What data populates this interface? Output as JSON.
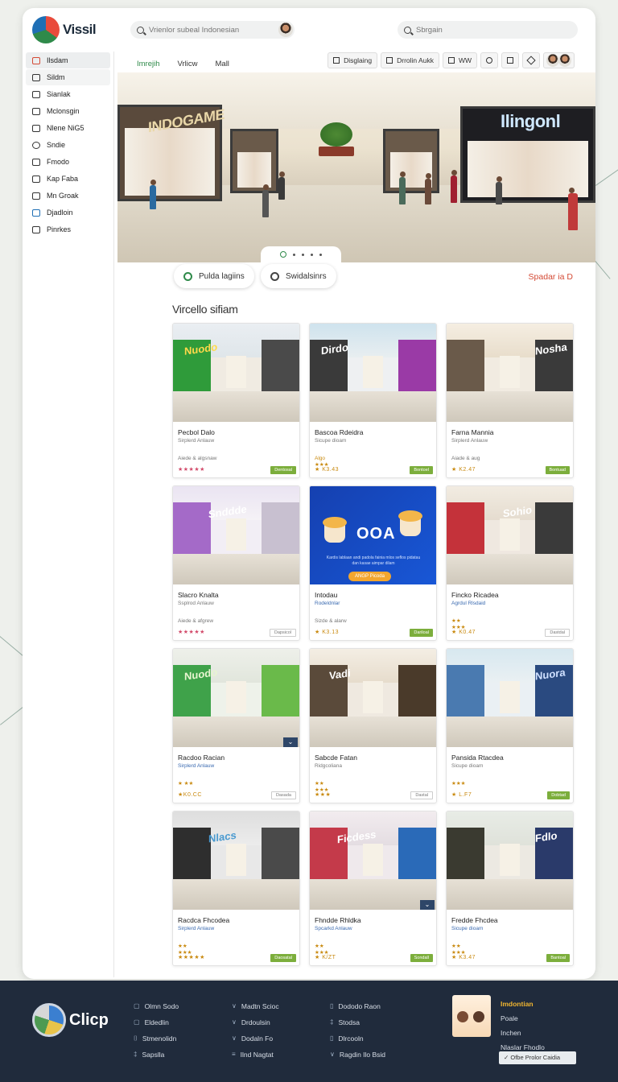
{
  "app": {
    "name": "Vissil"
  },
  "search_main": {
    "placeholder": "Vrienlor subeal Indonesian"
  },
  "search_right": {
    "placeholder": "Sbrgain"
  },
  "sidebar": {
    "items": [
      {
        "label": "Ilsdam",
        "icon": "map-icon"
      },
      {
        "label": "Sildm",
        "icon": "tag-icon"
      },
      {
        "label": "Sianlak",
        "icon": "store-icon"
      },
      {
        "label": "Mclonsgin",
        "icon": "chat-icon"
      },
      {
        "label": "Nlene NiG5",
        "icon": "news-icon"
      },
      {
        "label": "Sndie",
        "icon": "location-icon"
      },
      {
        "label": "Fmodo",
        "icon": "food-icon"
      },
      {
        "label": "Kap Faba",
        "icon": "gift-icon"
      },
      {
        "label": "Mn Groak",
        "icon": "camera-icon"
      },
      {
        "label": "Djadloin",
        "icon": "image-icon"
      },
      {
        "label": "Pinrkes",
        "icon": "users-icon"
      }
    ]
  },
  "topnav": [
    "Imrejih",
    "Vrlicw",
    "Mall"
  ],
  "toolbar": {
    "btn1": "Disglaing",
    "btn2": "Drrolin Aukk",
    "btn3": "WW"
  },
  "hero": {
    "sign_left": "INDOGAME",
    "sign_right": "Ilingonl"
  },
  "pills": {
    "left": "Pulda lagiins",
    "right": "Swidalsinrs"
  },
  "spotlight_link": "Spadar ia D",
  "section_title": "Vircello sifiam",
  "cards": [
    {
      "title": "Pecbol Dalo",
      "sub": "Sirplerd Anlauw",
      "meta": "Aiede & algsnaw",
      "rating": "★★★★★",
      "btn": "Dentosal",
      "sign": "Nuodo"
    },
    {
      "title": "Bascoa Rdeidra",
      "sub": "Sicupe dioam",
      "meta": "Algo\n★★★",
      "rating": "★ K3.43",
      "btn": "Bontoel",
      "sign": "Dirdo"
    },
    {
      "title": "Farna Mannia",
      "sub": "Sirplerd Anlauw",
      "meta": "Aiade & aug",
      "rating": "★ K2.47",
      "btn": "Bontuad",
      "sign": "Nosha"
    },
    {
      "title": "Slacro Knalta",
      "sub": "Ssplrod Anlauw",
      "meta": "Aiede & afgrew",
      "rating": "★★★★★",
      "btn": "Dapsicol",
      "sign": "Snddde"
    },
    {
      "title": "Intodau",
      "sub": "Rodeldnlar",
      "meta": "Sizde & alarw",
      "rating": "★ K3.13",
      "btn": "Dariloal",
      "promo": "OOA",
      "promo_desc": "Kardis lablaan andi padola fainia mlos seflos pidatau dan kasae aimpar dilam",
      "promo_btn": "ANGP Picoda"
    },
    {
      "title": "Fincko Ricadea",
      "sub": "Agrdul Rlsdaid",
      "meta": "★★\n★★★",
      "rating": "★ K0.47",
      "btn": "Dastdal",
      "sign": "Sohio"
    },
    {
      "title": "Racdoo Racian",
      "sub": "Sirplerd Anlauw",
      "meta": "★ ★★",
      "rating": "★K0.CC",
      "btn": "Dasada",
      "sign": "Nuodo"
    },
    {
      "title": "Sabcde Fatan",
      "sub": "Ridgcoliana",
      "meta": "★★\n★★★",
      "rating": "★★★",
      "btn": "Dastal",
      "sign": "Vadi"
    },
    {
      "title": "Pansida Rtacdea",
      "sub": "Sicupe dioam",
      "meta": "★★★",
      "rating": "★ L.F7",
      "btn": "Dobtad",
      "sign": "Nuora"
    },
    {
      "title": "Racdca Fhcodea",
      "sub": "Sirplerd Anlauw",
      "meta": "★★\n★★★",
      "rating": "★★★★★",
      "btn": "Daosatal",
      "sign": "Nlacs"
    },
    {
      "title": "Fhndde Rhldka",
      "sub": "Spcarkd Anlauw",
      "meta": "★★\n★★★",
      "rating": "★ K/ZT",
      "btn": "Sondall",
      "sign": "Ficdess"
    },
    {
      "title": "Fredde Fhcdea",
      "sub": "Sicupe dioam",
      "meta": "★★\n★★★",
      "rating": "★ K3.47",
      "btn": "Bantoal",
      "sign": "Fdlo"
    }
  ],
  "footer": {
    "brand": "Clicp",
    "col1": [
      "Olmn Sodo",
      "Eldedlin",
      "Stmenolidn",
      "Sapslla"
    ],
    "col2": [
      "Madtn Scioc",
      "Drdoulsin",
      "Dodaln Fo",
      "Ilnd Nagtat"
    ],
    "col3": [
      "Dododo Raon",
      "Stodsa",
      "Dlrcooln",
      "Ragdin Ilo Bsid"
    ],
    "right": [
      "Imdontian",
      "Poale",
      "Inchen",
      "Nlaslar Fhodlo"
    ],
    "button": "Ofbe Prolor Caidia"
  },
  "colors": {
    "accent": "#2f8a4a",
    "link": "#d44a35",
    "footer": "#202b3c"
  }
}
